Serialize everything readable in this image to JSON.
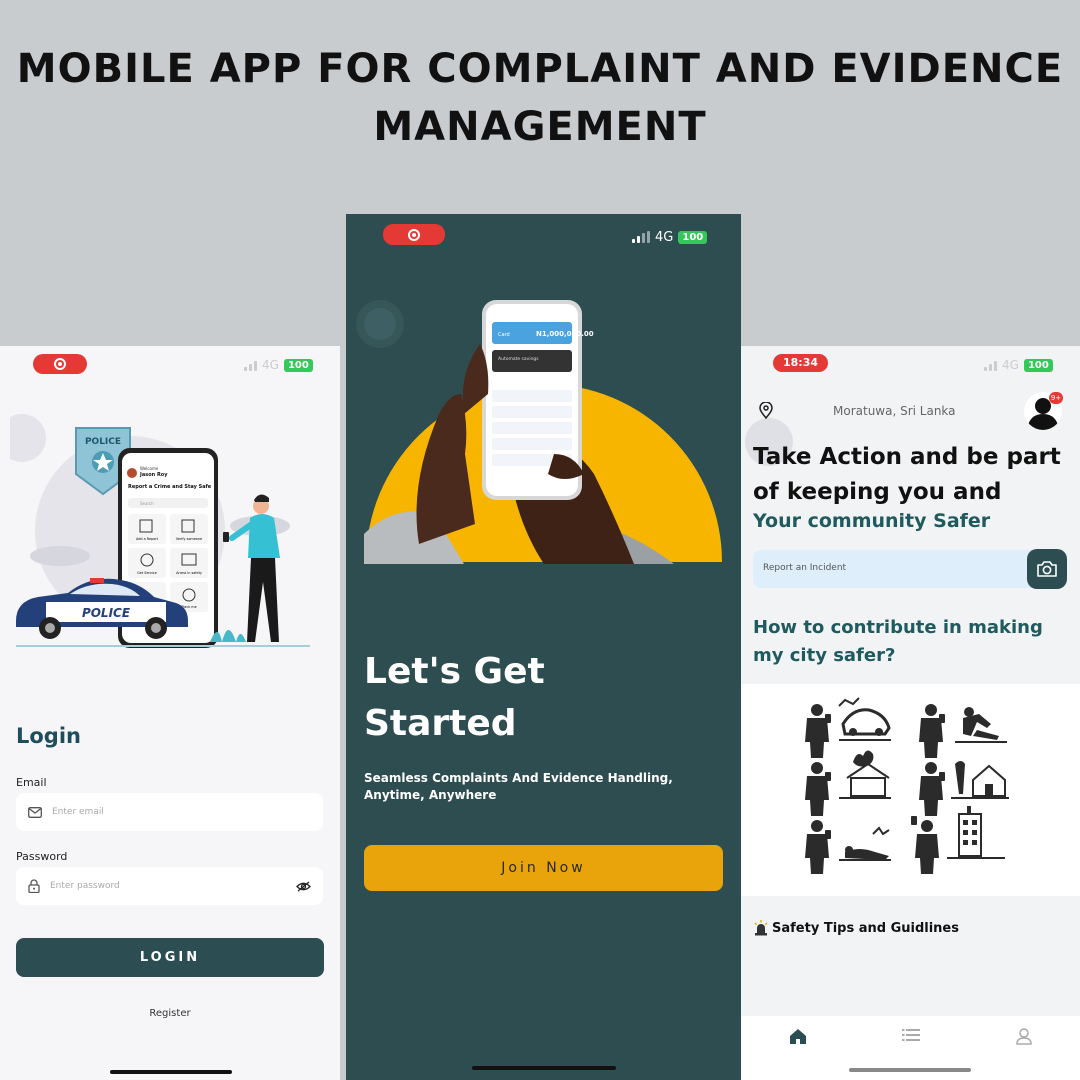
{
  "headline": {
    "line1": "MOBILE APP FOR COMPLAINT AND EVIDENCE",
    "line2": "MANAGEMENT"
  },
  "login_screen": {
    "status": {
      "network": "4G",
      "battery": "100"
    },
    "illustration_texts": {
      "badge": "POLICE",
      "car": "POLICE",
      "phone_greeting": "Welcome",
      "phone_user": "Jason Roy",
      "phone_heading": "Report a Crime and Stay Safe",
      "phone_search": "Search",
      "phone_tiles": [
        "Add a Report",
        "Verify someone",
        "Get Service",
        "Arrest in safety",
        "",
        "Track me"
      ]
    },
    "title": "Login",
    "email": {
      "label": "Email",
      "placeholder": "Enter email"
    },
    "password": {
      "label": "Password",
      "placeholder": "Enter password"
    },
    "login_button": "LOGIN",
    "register_link": "Register"
  },
  "start_screen": {
    "status": {
      "network": "4G",
      "battery": "100"
    },
    "mock_phone": {
      "card_label": "Card",
      "balance": "N1,000,000.00",
      "savings": "Automate savings"
    },
    "title_line1": "Let's Get",
    "title_line2": "Started",
    "subtitle": "Seamless Complaints And Evidence Handling, Anytime, Anywhere",
    "join_button": "Join Now"
  },
  "home_screen": {
    "status": {
      "time": "18:34",
      "network": "4G",
      "battery": "100"
    },
    "location": "Moratuwa, Sri Lanka",
    "notification_count": "9+",
    "heading_line1": "Take Action and be part",
    "heading_line2": "of keeping you and",
    "heading_accent": "Your community Safer",
    "report_placeholder": "Report an Incident",
    "contribute_title": "How to contribute in making my city safer?",
    "tips_title": "Safety Tips and Guidlines",
    "tabs": [
      "home-tab",
      "list-tab",
      "profile-tab"
    ]
  },
  "colors": {
    "primary_dark": "#2c4d52",
    "accent_yellow": "#e8a40a",
    "record_red": "#e53935",
    "battery_green": "#34c759"
  }
}
